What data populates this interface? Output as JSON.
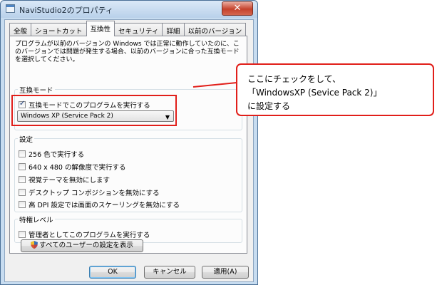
{
  "window": {
    "title": "NaviStudio2のプロパティ",
    "close_glyph": "✕"
  },
  "tabs": [
    "全般",
    "ショートカット",
    "互換性",
    "セキュリティ",
    "詳細",
    "以前のバージョン"
  ],
  "active_tab": "互換性",
  "description": "プログラムが以前のバージョンの Windows では正常に動作していたのに、このバージョンでは問題が発生する場合、以前のバージョンに合った互換モードを選択してください。",
  "compat_mode": {
    "group_label": "互換モード",
    "checkbox_label": "互換モードでこのプログラムを実行する",
    "checked": true,
    "selected": "Windows XP (Service Pack 2)"
  },
  "settings": {
    "group_label": "設定",
    "items": [
      {
        "label": "256 色で実行する",
        "checked": false
      },
      {
        "label": "640 x 480 の解像度で実行する",
        "checked": false
      },
      {
        "label": "視覚テーマを無効にします",
        "checked": false
      },
      {
        "label": "デスクトップ コンポジションを無効にする",
        "checked": false
      },
      {
        "label": "高 DPI 設定では画面のスケーリングを無効にする",
        "checked": false
      }
    ]
  },
  "privilege": {
    "group_label": "特権レベル",
    "checkbox_label": "管理者としてこのプログラムを実行する",
    "checked": false
  },
  "all_users_button": "すべてのユーザーの設定を表示",
  "buttons": {
    "ok": "OK",
    "cancel": "キャンセル",
    "apply": "適用(A)"
  },
  "callout": {
    "lines": [
      "ここにチェックをして、",
      "「WindowsXP (Sevice Pack 2)」",
      "に設定する"
    ]
  },
  "colors": {
    "annotation_red": "#e11f1a",
    "titlebar": "#c7dcf0"
  }
}
